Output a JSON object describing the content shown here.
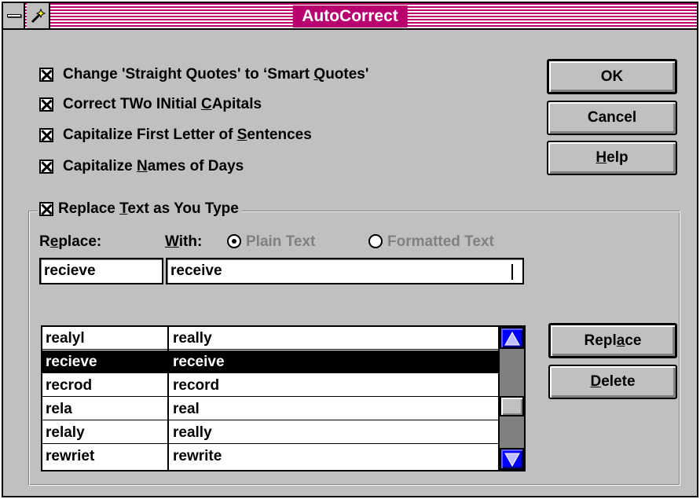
{
  "window": {
    "title": "AutoCorrect"
  },
  "options": [
    {
      "pre": "Change 'Straight Quotes' to ‘Smart ",
      "key": "Q",
      "post": "uotes'",
      "checked": true
    },
    {
      "pre": "Correct TWo INitial ",
      "key": "C",
      "post": "Apitals",
      "checked": true
    },
    {
      "pre": "Capitalize First Letter of ",
      "key": "S",
      "post": "entences",
      "checked": true
    },
    {
      "pre": "Capitalize ",
      "key": "N",
      "post": "ames of Days",
      "checked": true
    }
  ],
  "buttons": {
    "ok": "OK",
    "cancel": "Cancel",
    "help": {
      "pre": "",
      "key": "H",
      "post": "elp"
    },
    "replace": {
      "pre": "Repl",
      "key": "a",
      "post": "ce"
    },
    "delete": {
      "pre": "",
      "key": "D",
      "post": "elete"
    }
  },
  "replace_group": {
    "toggle": {
      "pre": "Replace ",
      "key": "T",
      "post": "ext as You Type",
      "checked": true
    },
    "replace_label": {
      "pre": "R",
      "key": "e",
      "post": "place:"
    },
    "with_label": {
      "pre": "",
      "key": "W",
      "post": "ith:"
    },
    "plain_text": "Plain Text",
    "formatted_text": "Formatted Text",
    "plain_selected": true,
    "replace_value": "recieve",
    "with_value": "receive"
  },
  "entries": [
    {
      "replace": "realyl",
      "with": "really",
      "selected": false
    },
    {
      "replace": "recieve",
      "with": "receive",
      "selected": true
    },
    {
      "replace": "recrod",
      "with": "record",
      "selected": false
    },
    {
      "replace": "rela",
      "with": "real",
      "selected": false
    },
    {
      "replace": "relaly",
      "with": "really",
      "selected": false
    },
    {
      "replace": "rewriet",
      "with": "rewrite",
      "selected": false
    }
  ],
  "icons": {
    "system_menu": "system-menu-icon",
    "wand": "magic-wand-icon",
    "scroll_up": "up-arrow-icon",
    "scroll_down": "down-arrow-icon"
  },
  "colors": {
    "title_bar": "#b8006f",
    "face": "#c0c0c0",
    "scroll_arrow": "#0000ff",
    "selection": "#000000"
  }
}
